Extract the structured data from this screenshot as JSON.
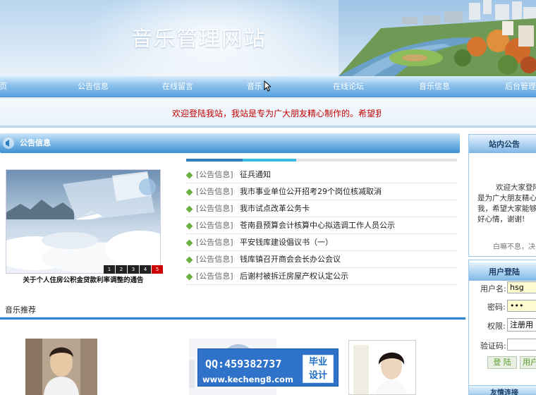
{
  "site": {
    "title": "音乐管理网站"
  },
  "nav": {
    "items": [
      {
        "label": "首页"
      },
      {
        "label": "公告信息"
      },
      {
        "label": "在线留言"
      },
      {
        "label": "音乐"
      },
      {
        "label": "在线论坛"
      },
      {
        "label": "音乐信息"
      },
      {
        "label": "后台管理"
      }
    ]
  },
  "marquee": {
    "text": "欢迎登陆我站，我站是专为广大朋友精心制作的。希望我"
  },
  "main": {
    "panel_title": "公告信息",
    "feature_caption": "关于个人住房公积金贷款利率调整的通告",
    "pager": [
      "1",
      "2",
      "3",
      "4",
      "5"
    ],
    "news": [
      {
        "category": "[公告信息]",
        "title": "征兵通知"
      },
      {
        "category": "[公告信息]",
        "title": "我市事业单位公开招考29个岗位核减取消"
      },
      {
        "category": "[公告信息]",
        "title": "我市试点改革公务卡"
      },
      {
        "category": "[公告信息]",
        "title": "苍南县预算会计核算中心拟选调工作人员公示"
      },
      {
        "category": "[公告信息]",
        "title": "平安钱库建设倡议书（一）"
      },
      {
        "category": "[公告信息]",
        "title": "钱库镇召开商会会长办公会议"
      },
      {
        "category": "[公告信息]",
        "title": "后谢村被拆迁房屋产权认定公示"
      }
    ],
    "music_section": "音乐推荐"
  },
  "watermark": {
    "qq": "QQ:459382737",
    "url": "www.kecheng8.com",
    "badge_line1": "毕业",
    "badge_line2": "设计"
  },
  "sidebar": {
    "notice_title": "站内公告",
    "notice_lines": [
      "欢迎大家登陆",
      "是为广大朋友精心",
      "我，希望大家能够",
      "好心情，谢谢!"
    ],
    "notice_cut": "白嘛不息，决",
    "login": {
      "title": "用户登陆",
      "username_label": "用户名:",
      "username_value": "hsg",
      "password_label": "密码:",
      "password_value": "•••",
      "role_label": "权限:",
      "role_value": "注册用",
      "captcha_label": "验证码:",
      "captcha_value": "",
      "login_button": "登 陆",
      "register_button": "用户"
    },
    "next_panel_title": "友情连接"
  }
}
